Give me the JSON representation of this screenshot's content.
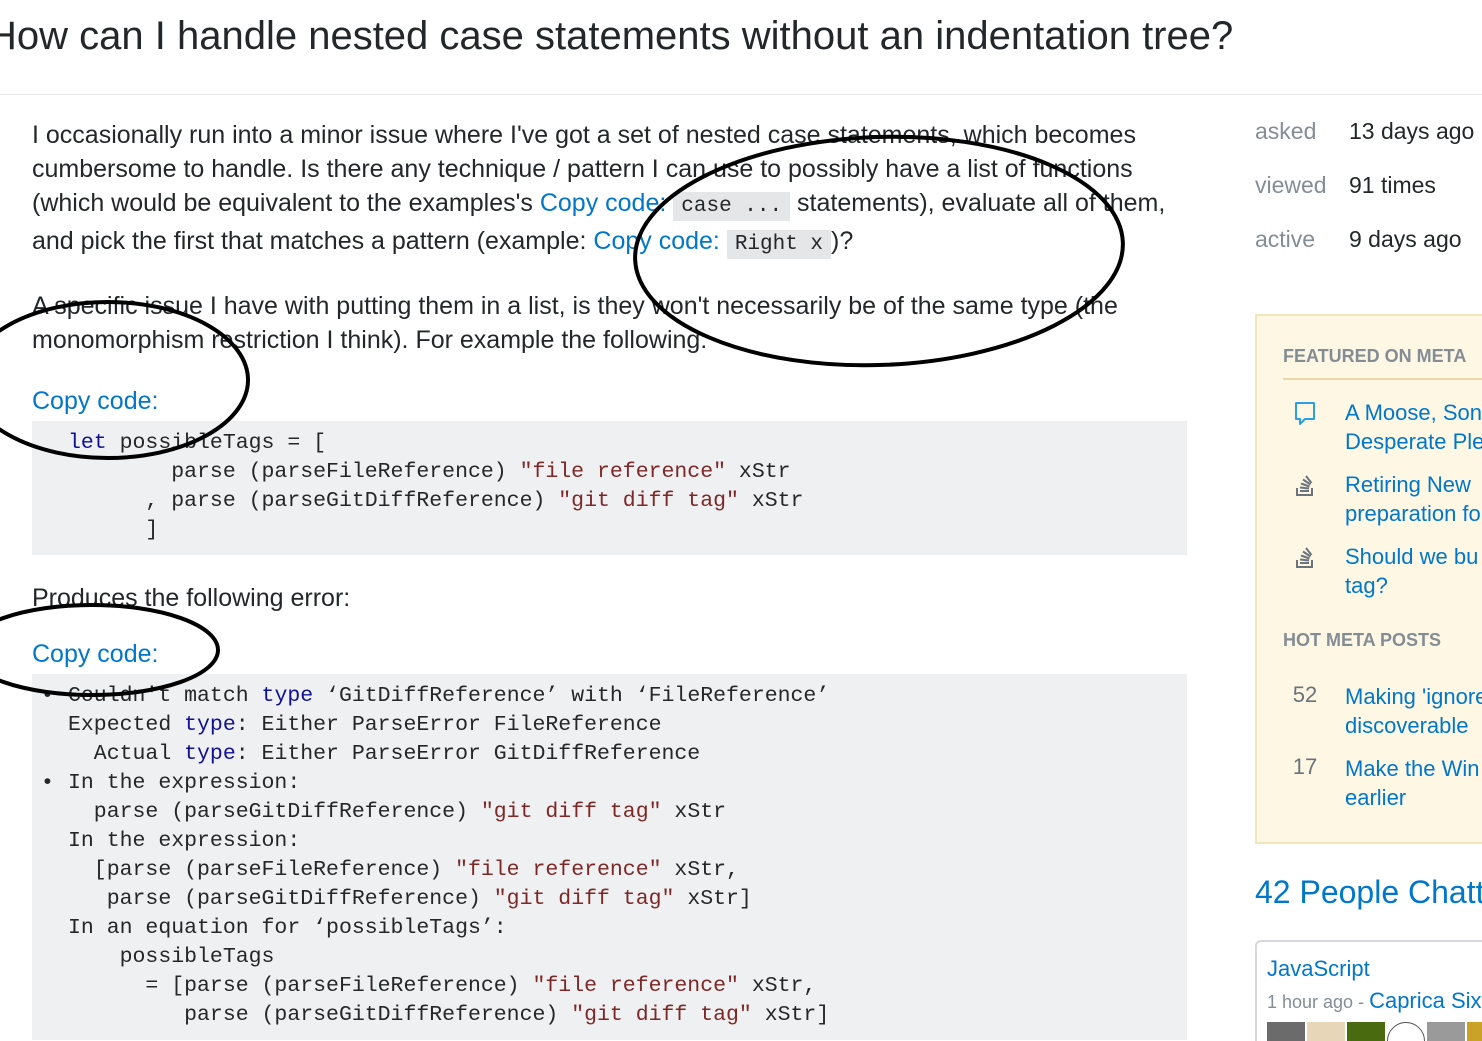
{
  "question": {
    "title": "How can I handle nested case statements without an indentation tree?"
  },
  "body": {
    "p1_text_a": "I occasionally run into a minor issue where I've got a set of nested case statements, which becomes cumbersome to handle. Is there any technique / pattern I can use to possibly have a list of functions (which would be equivalent to the examples's ",
    "p1_copy_1": "Copy code:",
    "p1_code_1": "case ...",
    "p1_text_b": " statements), evaluate all of them, and pick the first that matches a pattern (example: ",
    "p1_copy_2": "Copy code:",
    "p1_code_2": "Right x",
    "p1_text_c": ")?",
    "p2": "A specific issue I have with putting them in a list, is they won't necessarily be of the same type (the monomorphism restriction I think). For example the following:",
    "copy_label_1": "Copy code:",
    "code1": [
      {
        "kw": "let",
        "rest": " possibleTags = ["
      },
      {
        "pre": "        parse (parseFileReference) ",
        "str": "\"file reference\"",
        "post": " xStr"
      },
      {
        "pre": "      , parse (parseGitDiffReference) ",
        "str": "\"git diff tag\"",
        "post": " xStr"
      },
      {
        "pre": "      ]"
      }
    ],
    "p3": "Produces the following error:",
    "copy_label_2": "Copy code:",
    "code2": {
      "bullet": "•",
      "l1_a": "Couldn't match ",
      "l1_kw": "type",
      "l1_b": " ‘GitDiffReference’ with ‘FileReference’",
      "l2_a": "Expected ",
      "l2_kw": "type",
      "l2_b": ": Either ParseError FileReference",
      "l3_a": "  Actual ",
      "l3_kw": "type",
      "l3_b": ": Either ParseError GitDiffReference",
      "l4": "In the expression:",
      "l5_a": "  parse (parseGitDiffReference) ",
      "l5_str": "\"git diff tag\"",
      "l5_b": " xStr",
      "l6": "In the expression:",
      "l7_a": "  [parse (parseFileReference) ",
      "l7_str": "\"file reference\"",
      "l7_b": " xStr,",
      "l8_a": "   parse (parseGitDiffReference) ",
      "l8_str": "\"git diff tag\"",
      "l8_b": " xStr]",
      "l9": "In an equation for ‘possibleTags’:",
      "l10": "    possibleTags",
      "l11_a": "      = [parse (parseFileReference) ",
      "l11_str": "\"file reference\"",
      "l11_b": " xStr,",
      "l12_a": "         parse (parseGitDiffReference) ",
      "l12_str": "\"git diff tag\"",
      "l12_b": " xStr]"
    }
  },
  "stats": {
    "asked_label": "asked",
    "asked_value": "13 days ago",
    "viewed_label": "viewed",
    "viewed_value": "91 times",
    "active_label": "active",
    "active_value": "9 days ago"
  },
  "meta": {
    "featured_heading": "FEATURED ON META",
    "featured": [
      {
        "icon": "chat-bubble-icon",
        "line1": "A Moose, Son",
        "line2": "Desperate Ple"
      },
      {
        "icon": "stack-overflow-icon",
        "line1": "Retiring New",
        "line2": "preparation fo"
      },
      {
        "icon": "stack-overflow-icon",
        "line1": "Should we bu",
        "line2": "tag?"
      }
    ],
    "hot_heading": "HOT META POSTS",
    "hot": [
      {
        "count": "52",
        "line1": "Making 'ignore",
        "line2": "discoverable"
      },
      {
        "count": "17",
        "line1": "Make the Win",
        "line2": "earlier"
      }
    ]
  },
  "chat": {
    "heading": "42 People Chatt",
    "room": "JavaScript",
    "time": "1 hour ago - ",
    "who": "Caprica Six"
  },
  "colors": {
    "link": "#0077cc",
    "code_bg": "#eff0f1",
    "keyword": "#101094",
    "string": "#7d2727",
    "meta_bg": "#fdf7e3"
  }
}
